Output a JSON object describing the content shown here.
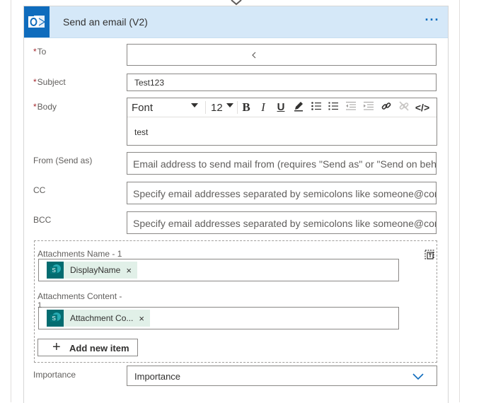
{
  "action": {
    "title": "Send an email (V2)",
    "more_label": "···"
  },
  "fields": {
    "to": {
      "label": "To",
      "required_mark": "*",
      "value": ""
    },
    "subject": {
      "label": "Subject",
      "required_mark": "*",
      "value": "Test123"
    },
    "body": {
      "label": "Body",
      "required_mark": "*",
      "value": "test",
      "toolbar": {
        "font": "Font",
        "size": "12",
        "bold": "B",
        "italic": "I",
        "underline": "U",
        "code": "</>"
      }
    },
    "from": {
      "label": "From (Send as)",
      "placeholder": "Email address to send mail from (requires \"Send as\" or \"Send on beh"
    },
    "cc": {
      "label": "CC",
      "placeholder": "Specify email addresses separated by semicolons like someone@con"
    },
    "bcc": {
      "label": "BCC",
      "placeholder": "Specify email addresses separated by semicolons like someone@con"
    }
  },
  "attachments": {
    "name_label": "Attachments Name - 1",
    "name_token": "DisplayName",
    "content_label_line1": "Attachments Content -",
    "content_label_line2": "1",
    "content_token": "Attachment Co...",
    "token_remove": "×",
    "add_button": "Add new item",
    "add_icon": "+"
  },
  "importance": {
    "label": "Importance",
    "value": "Importance"
  },
  "colors": {
    "header_bg": "#d5e8f8",
    "outlook_blue": "#0f6cbd",
    "sharepoint_teal": "#036c70",
    "required_red": "#a4262c"
  },
  "icons": {
    "connector": "chevron-down-icon",
    "app": "outlook-icon",
    "more": "more-icon",
    "token": "sharepoint-icon",
    "switch": "switch-input-mode-icon",
    "dropdown": "chevron-down-icon"
  }
}
